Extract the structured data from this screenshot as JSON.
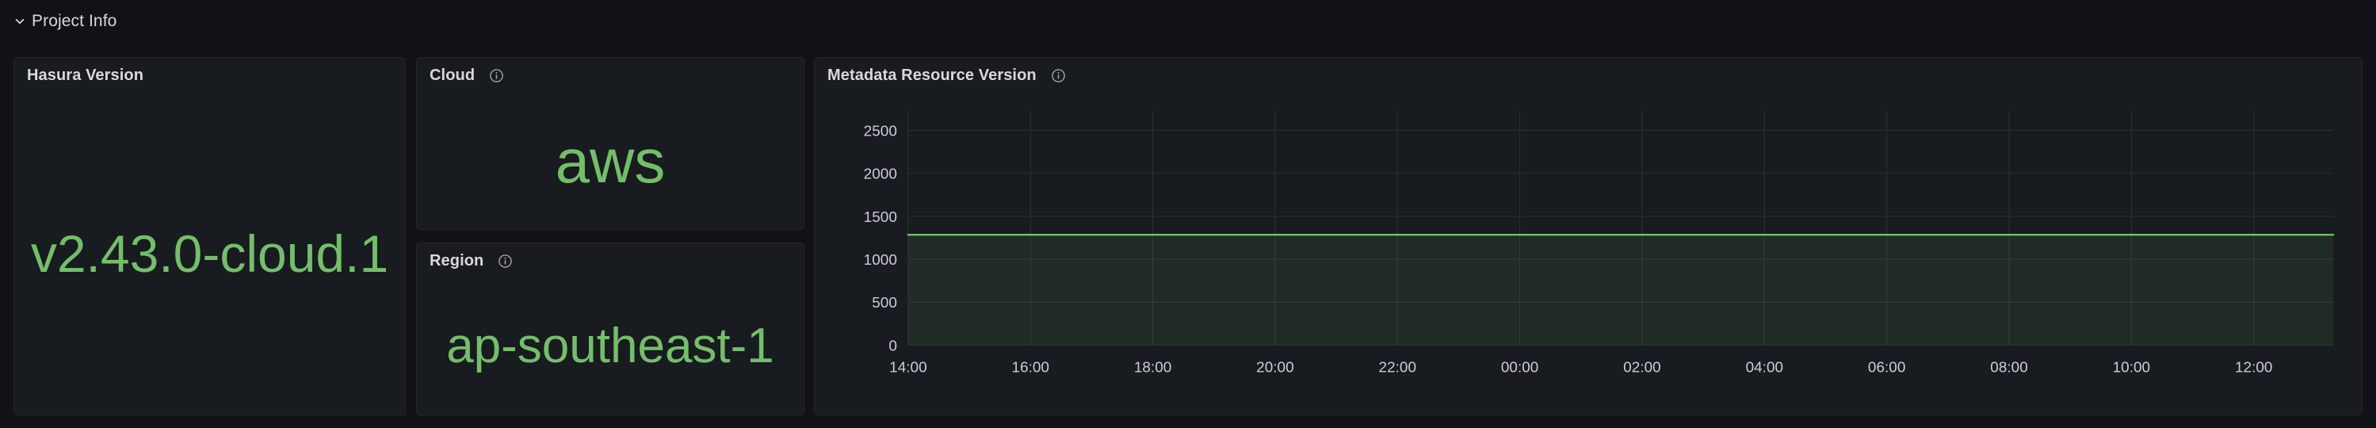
{
  "row": {
    "title": "Project Info",
    "expanded": true,
    "chevron_icon": "chevron-down-icon"
  },
  "panels": {
    "hasura_version": {
      "title": "Hasura Version",
      "value": "v2.43.0-cloud.1",
      "value_color": "#73bf69",
      "has_info": false
    },
    "cloud": {
      "title": "Cloud",
      "value": "aws",
      "value_color": "#73bf69",
      "has_info": true,
      "info_icon": "info-circle-icon"
    },
    "region": {
      "title": "Region",
      "value": "ap-southeast-1",
      "value_color": "#73bf69",
      "has_info": true,
      "info_icon": "info-circle-icon"
    },
    "metadata_resource_version": {
      "title": "Metadata Resource Version",
      "has_info": true,
      "info_icon": "info-circle-icon"
    }
  },
  "chart_data": {
    "type": "line",
    "title": "Metadata Resource Version",
    "xlabel": "",
    "ylabel": "",
    "grid": true,
    "legend_position": "none",
    "ylim": [
      0,
      2700
    ],
    "yticks": [
      0,
      500,
      1000,
      1500,
      2000,
      2500
    ],
    "ytick_labels": [
      "0",
      "500",
      "1000",
      "1500",
      "2000",
      "2500"
    ],
    "xtick_labels": [
      "14:00",
      "16:00",
      "18:00",
      "20:00",
      "22:00",
      "00:00",
      "02:00",
      "04:00",
      "06:00",
      "08:00",
      "10:00",
      "12:00"
    ],
    "series": [
      {
        "name": "Metadata Resource Version",
        "color": "#73bf69",
        "fill": true,
        "fill_opacity": 0.1,
        "x": [
          "14:00",
          "16:00",
          "18:00",
          "20:00",
          "22:00",
          "00:00",
          "02:00",
          "04:00",
          "06:00",
          "08:00",
          "10:00",
          "12:00"
        ],
        "values": [
          1285,
          1285,
          1285,
          1285,
          1285,
          1285,
          1285,
          1285,
          1285,
          1285,
          1285,
          1285
        ]
      }
    ]
  },
  "colors": {
    "page_background": "#111217",
    "panel_background": "#181b1f",
    "panel_border": "#24272b",
    "text_primary": "#d8d9df",
    "text_secondary": "#ccccdc",
    "accent_green": "#73bf69",
    "grid_line": "#2c3235"
  }
}
